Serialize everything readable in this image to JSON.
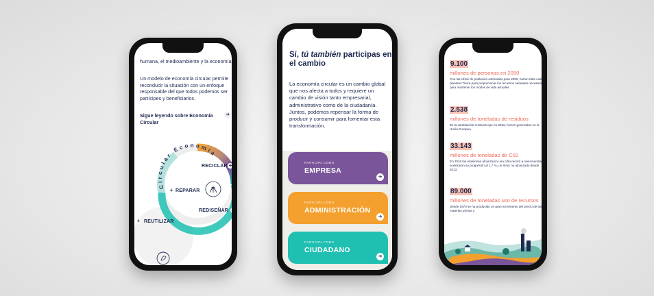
{
  "phone_left": {
    "intro_text": "humana, el medioambiente y la economía.",
    "paragraph": "Un modelo de economía circular permite reconducir la situación con un enfoque responsable del que todos podemos ser partícipes y beneficiarios.",
    "link_label": "Sigue leyendo sobre Economía Circular",
    "ring_title": "Circular Economía",
    "steps": [
      "RECICLAR",
      "REPARAR",
      "REDISEÑAR",
      "REUTILIZAR"
    ],
    "icons": [
      "head-plant-icon",
      "recycle-leaf-icon",
      "arrow-right-icon",
      "plus-icon"
    ]
  },
  "phone_center": {
    "title_prefix": "Sí, ",
    "title_emphasis": "tú también",
    "title_suffix": " participas en el cambio",
    "body": "La economía circular es un cambio global que nos afecta a todos y requiere un cambio de visión tanto empresarial, administrativo como de la ciudadanía. Juntos, podemos repensar la forma de producir y consumir para fomentar esta transformación.",
    "cards": [
      {
        "small": "PARTICIPA COMO",
        "label": "EMPRESA",
        "color": "#7a559a"
      },
      {
        "small": "PARTICIPA COMO",
        "label": "ADMINISTRACIÓN",
        "color": "#f3a02e"
      },
      {
        "small": "PARTICIPA COMO",
        "label": "CIUDADANO",
        "color": "#1fbfb1"
      }
    ]
  },
  "phone_right": {
    "stats": [
      {
        "number": "9.100",
        "unit": "millones de personas en 2050",
        "desc": "Con las cifras de población estimadas para 2050, harían falta casi 3 planetas Tierra para proporcionar los recursos naturales necesarios para mantener los modos de vida actuales."
      },
      {
        "number": "2.538",
        "unit": "millones de toneladas de residuos",
        "desc": "Es la cantidad de residuos que en 2016, fueron generados en la Unión Europea."
      },
      {
        "number": "33.143",
        "unit": "millones de toneladas de C02",
        "desc": "En 2016 las emisiones alcanzaron una cifra récord a nivel mundial y aceleraron su progresión al 1,7 %, un ritmo no alcanzado desde 2013."
      },
      {
        "number": "89.000",
        "unit": "millones de toneladas uso de recursos",
        "desc": "Desde 1970 se ha producido un gran incremento del precio de las materias primas y"
      }
    ]
  },
  "colors": {
    "navy": "#1f2a52",
    "coral": "#ef6a5a",
    "purple": "#7a559a",
    "orange": "#f3a02e",
    "teal": "#1fbfb1"
  }
}
